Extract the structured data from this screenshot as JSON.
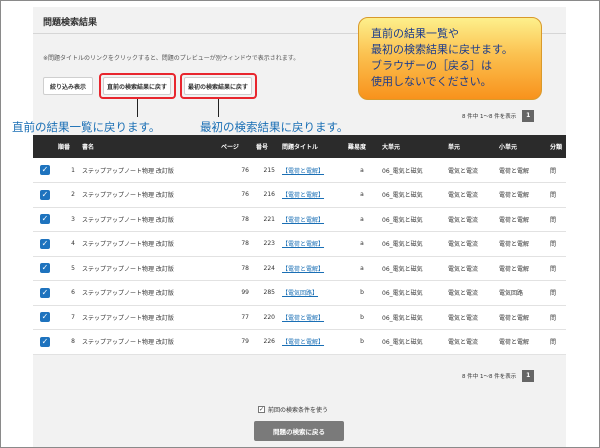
{
  "panel": {
    "title": "問題検索結果",
    "instruction": "※問題タイトルのリンクをクリックすると、問題のプレビューが別ウィンドウで表示されます。"
  },
  "toolbar": {
    "filter_label": "絞り込み表示",
    "back_prev_label": "直前の検索結果に戻す",
    "back_first_label": "最初の検索結果に戻す"
  },
  "annotations": {
    "left_note": "直前の結果一覧に戻ります。",
    "right_note": "最初の検索結果に戻ります。",
    "callout_lines": [
      "直前の結果一覧や",
      "最初の検索結果に戻せます。",
      "ブラウザーの［戻る］は",
      "使用しないでください。"
    ],
    "callout_color": "#f8921c",
    "highlight_color": "#e8262e"
  },
  "pagination": {
    "summary": "8 件中 1〜8 件を表示",
    "page": "1"
  },
  "table": {
    "headers": [
      "",
      "順番",
      "書名",
      "ページ",
      "番号",
      "問題タイトル",
      "難易度",
      "大単元",
      "単元",
      "小単元",
      "分類"
    ],
    "rows": [
      {
        "order": "1",
        "book": "ステップアップノート物理 改訂版",
        "page": "76",
        "no": "215",
        "title": "【電荷と電解】",
        "diff": "a",
        "major": "06_電気と磁気",
        "unit": "電気と電流",
        "minor": "電荷と電解",
        "cls": "問"
      },
      {
        "order": "2",
        "book": "ステップアップノート物理 改訂版",
        "page": "76",
        "no": "216",
        "title": "【電荷と電解】",
        "diff": "a",
        "major": "06_電気と磁気",
        "unit": "電気と電流",
        "minor": "電荷と電解",
        "cls": "問"
      },
      {
        "order": "3",
        "book": "ステップアップノート物理 改訂版",
        "page": "78",
        "no": "221",
        "title": "【電荷と電解】",
        "diff": "a",
        "major": "06_電気と磁気",
        "unit": "電気と電流",
        "minor": "電荷と電解",
        "cls": "問"
      },
      {
        "order": "4",
        "book": "ステップアップノート物理 改訂版",
        "page": "78",
        "no": "223",
        "title": "【電荷と電解】",
        "diff": "a",
        "major": "06_電気と磁気",
        "unit": "電気と電流",
        "minor": "電荷と電解",
        "cls": "問"
      },
      {
        "order": "5",
        "book": "ステップアップノート物理 改訂版",
        "page": "78",
        "no": "224",
        "title": "【電荷と電解】",
        "diff": "a",
        "major": "06_電気と磁気",
        "unit": "電気と電流",
        "minor": "電荷と電解",
        "cls": "問"
      },
      {
        "order": "6",
        "book": "ステップアップノート物理 改訂版",
        "page": "99",
        "no": "285",
        "title": "【電気回路】",
        "diff": "b",
        "major": "06_電気と磁気",
        "unit": "電気と電流",
        "minor": "電気回路",
        "cls": "問"
      },
      {
        "order": "7",
        "book": "ステップアップノート物理 改訂版",
        "page": "77",
        "no": "220",
        "title": "【電荷と電解】",
        "diff": "b",
        "major": "06_電気と磁気",
        "unit": "電気と電流",
        "minor": "電荷と電解",
        "cls": "問"
      },
      {
        "order": "8",
        "book": "ステップアップノート物理 改訂版",
        "page": "79",
        "no": "226",
        "title": "【電荷と電解】",
        "diff": "b",
        "major": "06_電気と磁気",
        "unit": "電気と電流",
        "minor": "電荷と電解",
        "cls": "問"
      }
    ]
  },
  "footer": {
    "prev_condition_label": "前回の検索条件を使う",
    "back_to_search_label": "問題の検索に戻る"
  },
  "icons": {
    "check": "✓"
  }
}
